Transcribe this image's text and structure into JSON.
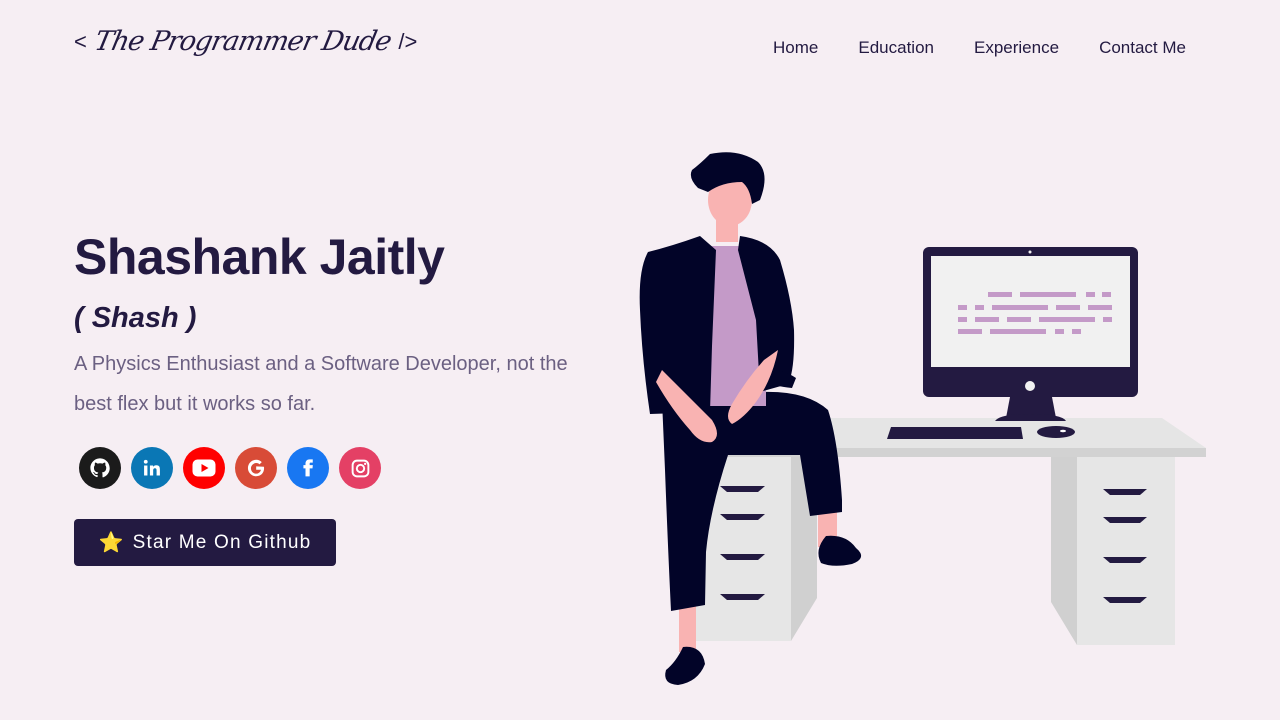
{
  "header": {
    "logo_open": "<",
    "logo_text": "The Programmer Dude",
    "logo_close": "/>"
  },
  "nav": {
    "items": [
      {
        "label": "Home"
      },
      {
        "label": "Education"
      },
      {
        "label": "Experience"
      },
      {
        "label": "Contact Me"
      }
    ]
  },
  "hero": {
    "name": "Shashank Jaitly",
    "nickname": "( Shash )",
    "description": "A Physics Enthusiast and a Software Developer, not the best flex but it works so far."
  },
  "socials": [
    {
      "icon": "github-icon",
      "color": "#1b1b1b"
    },
    {
      "icon": "linkedin-icon",
      "color": "#0a77b5"
    },
    {
      "icon": "youtube-icon",
      "color": "#ff0000"
    },
    {
      "icon": "google-icon",
      "color": "#d84b37"
    },
    {
      "icon": "facebook-icon",
      "color": "#1877f2"
    },
    {
      "icon": "instagram-icon",
      "color": "#e44065"
    }
  ],
  "cta": {
    "star_glyph": "⭐",
    "label": "Star Me On Github"
  },
  "colors": {
    "background": "#f6eef3",
    "primary": "#231a41",
    "text_muted": "#6b6082",
    "accent_purple": "#c49ac8"
  }
}
